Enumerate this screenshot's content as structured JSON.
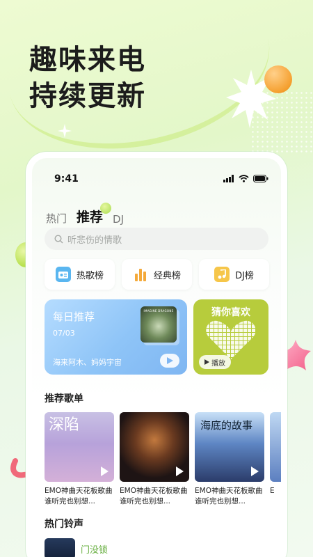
{
  "promo": {
    "headline_line1": "趣味来电",
    "headline_line2": "持续更新"
  },
  "phone": {
    "status_time": "9:41",
    "tabs": [
      {
        "label": "热门",
        "active": false
      },
      {
        "label": "推荐",
        "active": true
      },
      {
        "label": "DJ",
        "active": false
      }
    ],
    "search_placeholder": "听悲伤的情歌",
    "charts": [
      {
        "label": "热歌榜",
        "icon": "radio-icon",
        "color": "#5ab6f0"
      },
      {
        "label": "经典榜",
        "icon": "bar-chart-icon",
        "color": "#f4a93a"
      },
      {
        "label": "DJ榜",
        "icon": "music-note-icon",
        "color": "#f6c64a"
      }
    ],
    "daily": {
      "title": "每日推荐",
      "date": "07/03",
      "artists": "海来阿木、妈妈宇宙",
      "cover_text": "IMAGINE DRAGONS"
    },
    "guess": {
      "title": "猜你喜欢",
      "play_label": "播放"
    },
    "playlist_section_title": "推荐歌单",
    "playlists": [
      {
        "title": "EMO神曲天花板歌曲 谁听完也别想...",
        "cover_text": "深陷"
      },
      {
        "title": "EMO神曲天花板歌曲 谁听完也别想...",
        "cover_text": ""
      },
      {
        "title": "EMO神曲天花板歌曲 谁听完也别想...",
        "cover_text": "海底的故事"
      },
      {
        "title": "E",
        "cover_text": ""
      }
    ],
    "ringtone_section_title": "热门铃声",
    "ringtone_first": "门没锁"
  },
  "colors": {
    "accent_green": "#b7cc3c",
    "daily_blue": "#8ec4f7"
  }
}
